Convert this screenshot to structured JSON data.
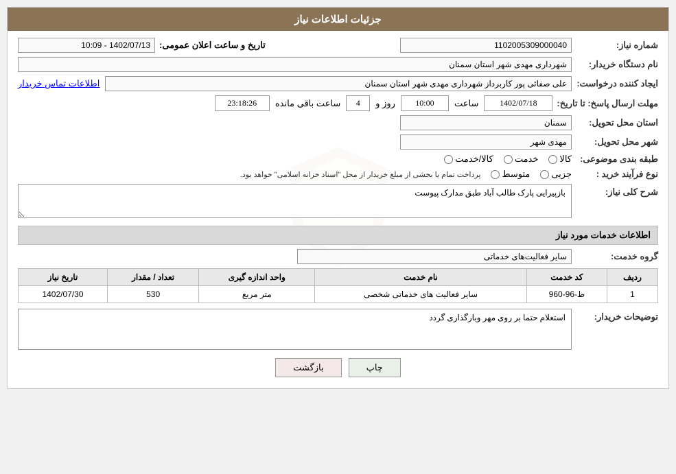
{
  "header": {
    "title": "جزئیات اطلاعات نیاز"
  },
  "fields": {
    "need_number_label": "شماره نیاز:",
    "need_number_value": "1102005309000040",
    "announce_label": "تاریخ و ساعت اعلان عمومی:",
    "announce_value": "1402/07/13 - 10:09",
    "buyer_label": "نام دستگاه خریدار:",
    "buyer_value": "شهرداری مهدی شهر استان سمنان",
    "creator_label": "ایجاد کننده درخواست:",
    "creator_value": "علی صفائی پور کاربرداز شهرداری مهدی شهر استان سمنان",
    "contact_link": "اطلاعات تماس خریدار",
    "deadline_label": "مهلت ارسال پاسخ: تا تاریخ:",
    "deadline_date": "1402/07/18",
    "deadline_time_label": "ساعت",
    "deadline_time": "10:00",
    "deadline_day_label": "روز و",
    "deadline_days": "4",
    "deadline_remaining_label": "ساعت باقی مانده",
    "deadline_remaining": "23:18:26",
    "province_label": "استان محل تحویل:",
    "province_value": "سمنان",
    "city_label": "شهر محل تحویل:",
    "city_value": "مهدی شهر",
    "category_label": "طبقه بندی موضوعی:",
    "category_kala": "کالا",
    "category_khadamat": "خدمت",
    "category_kala_khadamat": "کالا/خدمت",
    "purchase_type_label": "نوع فرآیند خرید :",
    "purchase_jozei": "جزیی",
    "purchase_motavasset": "متوسط",
    "purchase_note": "پرداخت تمام یا بخشی از مبلغ خریدار از محل \"اسناد خزانه اسلامی\" خواهد بود.",
    "description_label": "شرح کلی نیاز:",
    "description_value": "بازپیرایی پارک طالب آباد طبق مدارک پیوست",
    "services_section_label": "اطلاعات خدمات مورد نیاز",
    "service_group_label": "گروه خدمت:",
    "service_group_value": "سایر فعالیت‌های خدماتی",
    "table": {
      "col_radif": "ردیف",
      "col_code": "کد خدمت",
      "col_name": "نام خدمت",
      "col_measure": "واحد اندازه گیری",
      "col_count": "تعداد / مقدار",
      "col_date": "تاریخ نیاز",
      "rows": [
        {
          "radif": "1",
          "code": "ط-96-960",
          "name": "سایر فعالیت های خدماتی شخصی",
          "measure": "متر مربع",
          "count": "530",
          "date": "1402/07/30"
        }
      ]
    },
    "buyer_notes_label": "توضیحات خریدار:",
    "buyer_notes_value": "استعلام حتما بر روی مهر وبارگذاری گردد"
  },
  "buttons": {
    "print": "چاپ",
    "back": "بازگشت"
  }
}
